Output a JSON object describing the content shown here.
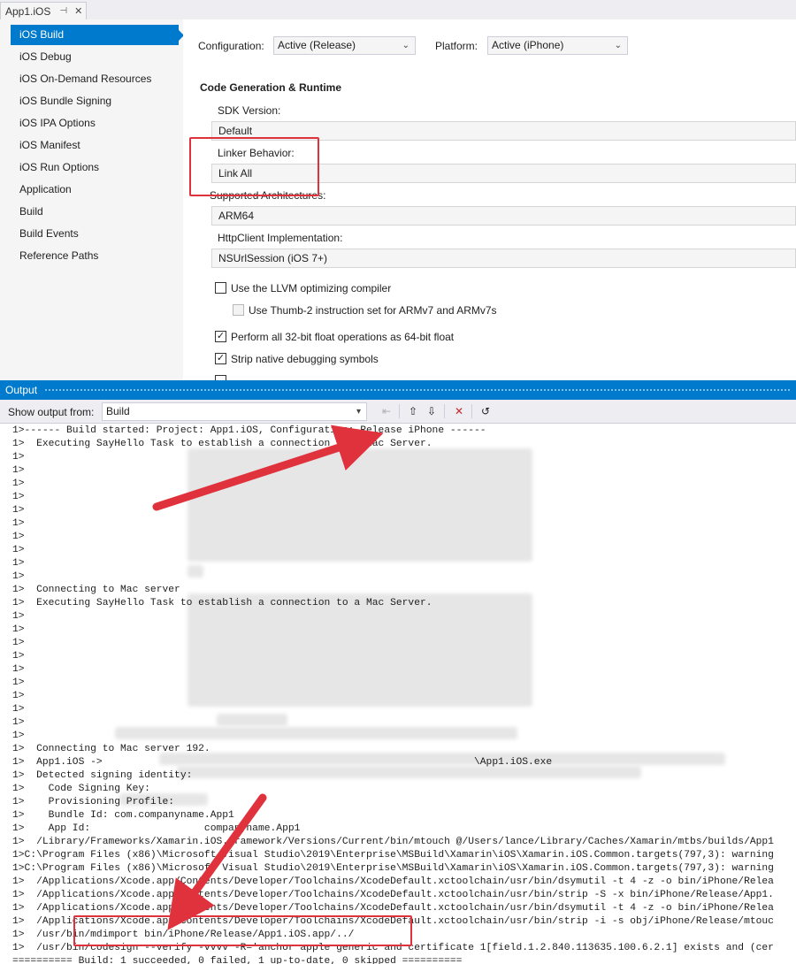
{
  "tab": {
    "title": "App1.iOS",
    "pin": "⊣",
    "close": "✕"
  },
  "nav": {
    "items": [
      {
        "label": "iOS Build"
      },
      {
        "label": "iOS Debug"
      },
      {
        "label": "iOS On-Demand Resources"
      },
      {
        "label": "iOS Bundle Signing"
      },
      {
        "label": "iOS IPA Options"
      },
      {
        "label": "iOS Manifest"
      },
      {
        "label": "iOS Run Options"
      },
      {
        "label": "Application"
      },
      {
        "label": "Build"
      },
      {
        "label": "Build Events"
      },
      {
        "label": "Reference Paths"
      }
    ],
    "selected": "iOS Build"
  },
  "props": {
    "configuration_label": "Configuration:",
    "configuration_value": "Active (Release)",
    "platform_label": "Platform:",
    "platform_value": "Active (iPhone)",
    "section_title": "Code Generation & Runtime",
    "sdk_label": "SDK Version:",
    "sdk_value": "Default",
    "linker_label": "Linker Behavior:",
    "linker_value": "Link All",
    "arch_label": "Supported Architectures:",
    "arch_value": "ARM64",
    "http_label": "HttpClient Implementation:",
    "http_value": "NSUrlSession (iOS 7+)",
    "llvm_label": "Use the LLVM optimizing compiler",
    "llvm_checked": false,
    "thumb_label": "Use Thumb-2 instruction set for ARMv7 and ARMv7s",
    "thumb_checked": false,
    "float_label": "Perform all 32-bit float operations as 64-bit float",
    "float_checked": true,
    "strip_label": "Strip native debugging symbols",
    "strip_checked": true,
    "check_mark": "✓"
  },
  "output": {
    "title": "Output",
    "show_from_label": "Show output from:",
    "show_from_value": "Build",
    "lines": [
      "1>------ Build started: Project: App1.iOS, Configuration: Release iPhone ------",
      "1>  Executing SayHello Task to establish a connection to a Mac Server.",
      "1>",
      "1>",
      "1>",
      "1>",
      "1>",
      "1>",
      "1>",
      "1>",
      "1>",
      "1>",
      "1>  Connecting to Mac server",
      "1>  Executing SayHello Task to establish a connection to a Mac Server.",
      "1>",
      "1>",
      "1>",
      "1>",
      "1>",
      "1>",
      "1>",
      "1>",
      "1>",
      "1>",
      "1>  Connecting to Mac server 192.",
      "1>  App1.iOS ->                                                              \\App1.iOS.exe",
      "1>  Detected signing identity:",
      "1>    Code Signing Key:",
      "1>    Provisioning Profile:",
      "1>    Bundle Id: com.companyname.App1",
      "1>    App Id:                   companyname.App1",
      "1>  /Library/Frameworks/Xamarin.iOS.framework/Versions/Current/bin/mtouch @/Users/lance/Library/Caches/Xamarin/mtbs/builds/App1",
      "1>C:\\Program Files (x86)\\Microsoft Visual Studio\\2019\\Enterprise\\MSBuild\\Xamarin\\iOS\\Xamarin.iOS.Common.targets(797,3): warning",
      "1>C:\\Program Files (x86)\\Microsoft Visual Studio\\2019\\Enterprise\\MSBuild\\Xamarin\\iOS\\Xamarin.iOS.Common.targets(797,3): warning",
      "1>  /Applications/Xcode.app/Contents/Developer/Toolchains/XcodeDefault.xctoolchain/usr/bin/dsymutil -t 4 -z -o bin/iPhone/Relea",
      "1>  /Applications/Xcode.app/Contents/Developer/Toolchains/XcodeDefault.xctoolchain/usr/bin/strip -S -x bin/iPhone/Release/App1.",
      "1>  /Applications/Xcode.app/Contents/Developer/Toolchains/XcodeDefault.xctoolchain/usr/bin/dsymutil -t 4 -z -o bin/iPhone/Relea",
      "1>  /Applications/Xcode.app/Contents/Developer/Toolchains/XcodeDefault.xctoolchain/usr/bin/strip -i -s obj/iPhone/Release/mtouc",
      "1>  /usr/bin/mdimport bin/iPhone/Release/App1.iOS.app/../",
      "1>  /usr/bin/codesign --verify -vvvv -R='anchor apple generic and certificate 1[field.1.2.840.113635.100.6.2.1] exists and (cer",
      "========== Build: 1 succeeded, 0 failed, 1 up-to-date, 0 skipped =========="
    ]
  },
  "colors": {
    "accent": "#007acc",
    "highlight": "#e0323c"
  }
}
